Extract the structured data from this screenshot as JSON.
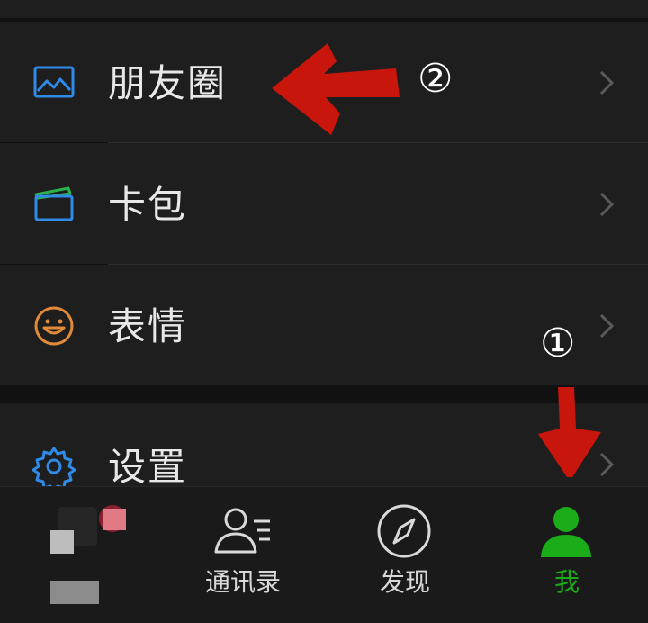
{
  "menu": {
    "items": [
      {
        "label": "朋友圈",
        "icon": "moments-image-icon"
      },
      {
        "label": "卡包",
        "icon": "card-wallet-icon"
      },
      {
        "label": "表情",
        "icon": "smiley-face-icon"
      },
      {
        "label": "设置",
        "icon": "gear-icon"
      }
    ]
  },
  "tabbar": {
    "tabs": [
      {
        "label": "",
        "icon": "blurred-chat-icon"
      },
      {
        "label": "通讯录",
        "icon": "contacts-icon"
      },
      {
        "label": "发现",
        "icon": "compass-icon"
      },
      {
        "label": "我",
        "icon": "person-icon",
        "active": true
      }
    ]
  },
  "annotations": {
    "step1": "①",
    "step2": "②"
  },
  "colors": {
    "accent_green": "#1aad19",
    "icon_blue": "#2f8ae8",
    "icon_orange": "#e08a3a",
    "arrow_red": "#c8160c"
  }
}
